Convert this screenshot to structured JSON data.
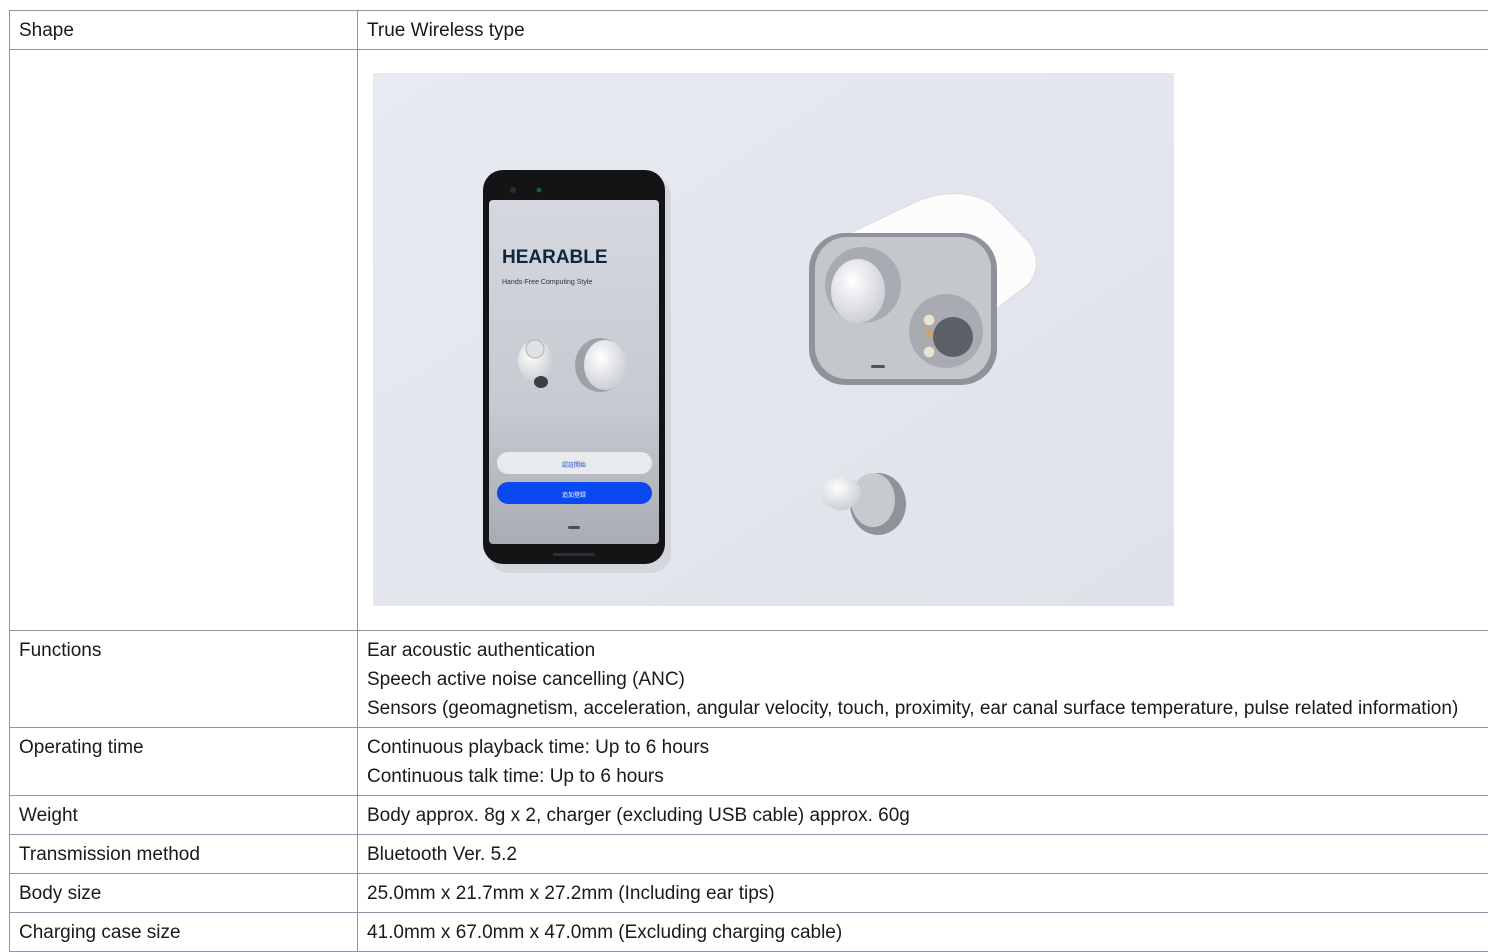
{
  "rows": [
    {
      "label": "Shape",
      "values": [
        "True Wireless type"
      ]
    },
    {
      "label": "",
      "image": {
        "phone_title": "HEARABLE",
        "phone_subtitle": "Hands-Free Computing Style",
        "btn_auth": "認証開始",
        "btn_add": "追加登録"
      }
    },
    {
      "label": "Functions",
      "values": [
        "Ear acoustic authentication",
        "Speech active noise cancelling (ANC)",
        "Sensors (geomagnetism, acceleration, angular velocity, touch, proximity, ear canal surface temperature, pulse related information)"
      ]
    },
    {
      "label": "Operating time",
      "values": [
        "Continuous playback time: Up to 6 hours",
        "Continuous talk time: Up to 6 hours"
      ]
    },
    {
      "label": "Weight",
      "values": [
        "Body approx. 8g x 2, charger (excluding USB cable) approx. 60g"
      ]
    },
    {
      "label": "Transmission method",
      "values": [
        "Bluetooth Ver. 5.2"
      ]
    },
    {
      "label": "Body size",
      "values": [
        "25.0mm x 21.7mm x 27.2mm (Including ear tips)"
      ]
    },
    {
      "label": "Charging case size",
      "values": [
        "41.0mm x 67.0mm x 47.0mm (Excluding charging cable)"
      ]
    }
  ]
}
